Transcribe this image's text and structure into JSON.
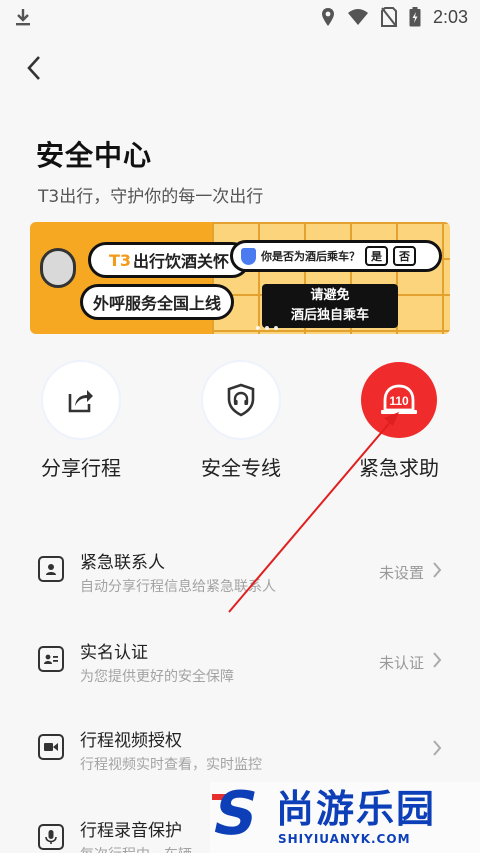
{
  "status_bar": {
    "time": "2:03"
  },
  "header": {
    "title": "安全中心",
    "subtitle": "T3出行，守护你的每一次出行"
  },
  "banner": {
    "brand": "T3",
    "tag_text": "出行饮酒关怀",
    "line2": "外呼服务全国上线",
    "question": "你是否为酒后乘车？",
    "yes": "是",
    "no": "否",
    "tip_line1": "请避免",
    "tip_line2": "酒后独自乘车"
  },
  "quick_actions": [
    {
      "label": "分享行程",
      "icon": "share-icon"
    },
    {
      "label": "安全专线",
      "icon": "shield-headset-icon"
    },
    {
      "label": "紧急求助",
      "icon": "alarm-110-icon",
      "icon_text": "110",
      "color": "#ef2b2b"
    }
  ],
  "list": [
    {
      "title": "紧急联系人",
      "desc": "自动分享行程信息给紧急联系人",
      "status": "未设置",
      "icon": "contact-icon"
    },
    {
      "title": "实名认证",
      "desc": "为您提供更好的安全保障",
      "status": "未认证",
      "icon": "id-card-icon"
    },
    {
      "title": "行程视频授权",
      "desc": "行程视频实时查看，实时监控",
      "status": "",
      "icon": "video-icon"
    },
    {
      "title": "行程录音保护",
      "desc": "每次行程中，车辆",
      "status": "",
      "icon": "microphone-icon"
    }
  ],
  "watermark": {
    "cn": "尚游乐园",
    "en": "SHIYIUANYK.COM",
    "letter": "S"
  },
  "colors": {
    "accent_red": "#ef2b2b",
    "watermark_blue": "#0d3fb8",
    "banner_orange": "#f6a823"
  }
}
